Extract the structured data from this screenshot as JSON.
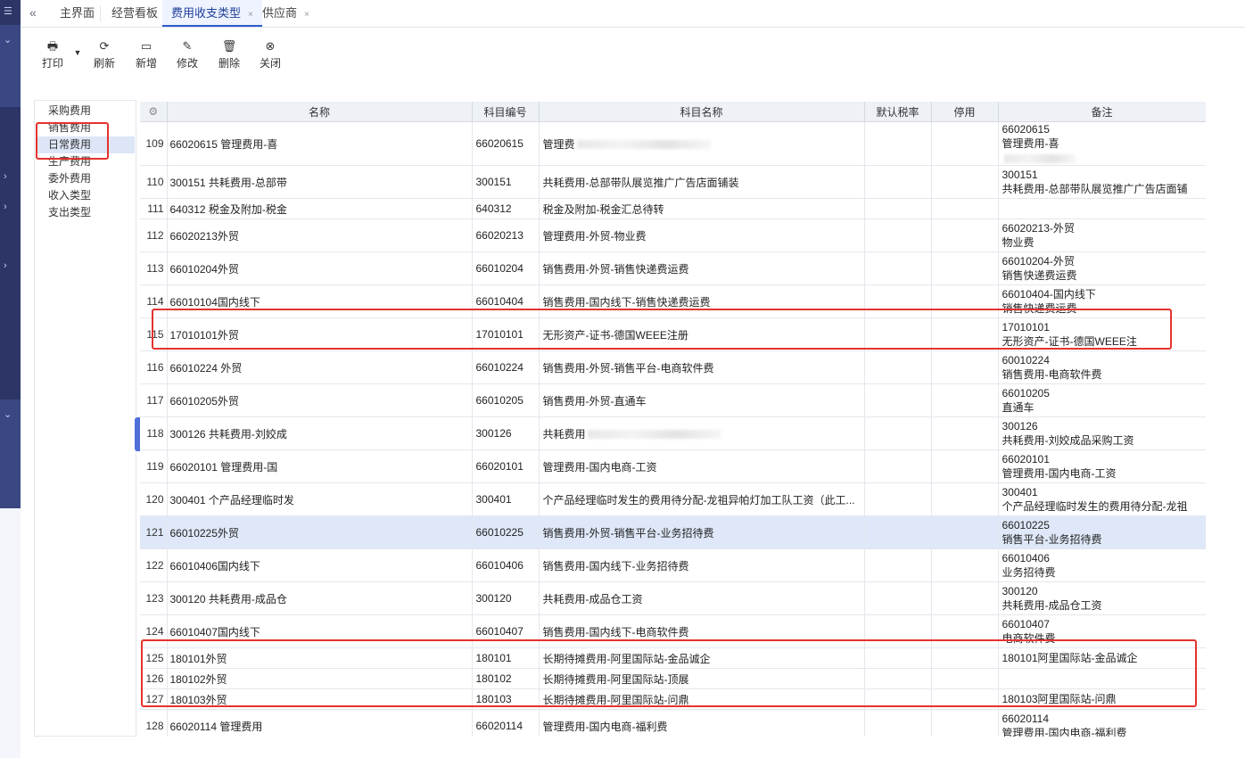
{
  "tabs": [
    {
      "label": "主界面",
      "active": false,
      "closable": false
    },
    {
      "label": "经营看板",
      "active": false,
      "closable": false
    },
    {
      "label": "费用收支类型",
      "active": true,
      "closable": true
    },
    {
      "label": "供应商",
      "active": false,
      "closable": true
    }
  ],
  "toolbar": {
    "print": "打印",
    "refresh": "刷新",
    "add": "新增",
    "edit": "修改",
    "delete": "删除",
    "close": "关闭"
  },
  "type_list": [
    "采购费用",
    "销售费用",
    "日常费用",
    "生产费用",
    "委外费用",
    "收入类型",
    "支出类型"
  ],
  "grid": {
    "columns": [
      "名称",
      "科目编号",
      "科目名称",
      "默认税率",
      "停用",
      "备注"
    ],
    "rows": [
      {
        "idx": "109",
        "name": "66020615 管理费用-喜",
        "code": "66020615",
        "subject": "管理费",
        "note1": "66020615",
        "note2": "管理费用-喜",
        "blur_subject": true,
        "blur_note": true
      },
      {
        "idx": "110",
        "name": "300151 共耗费用-总部带",
        "code": "300151",
        "subject": "共耗费用-总部带队展览推广广告店面铺装",
        "note1": "300151",
        "note2": "共耗费用-总部带队展览推广广告店面铺"
      },
      {
        "idx": "111",
        "name": "640312 税金及附加-税金",
        "code": "640312",
        "subject": "税金及附加-税金汇总待转",
        "note1": "",
        "note2": "",
        "short": true
      },
      {
        "idx": "112",
        "name": "66020213外贸",
        "code": "66020213",
        "subject": "管理费用-外贸-物业费",
        "note1": "66020213-外贸",
        "note2": "物业费"
      },
      {
        "idx": "113",
        "name": "66010204外贸",
        "code": "66010204",
        "subject": "销售费用-外贸-销售快递费运费",
        "note1": "66010204-外贸",
        "note2": "销售快递费运费"
      },
      {
        "idx": "114",
        "name": "66010104国内线下",
        "code": "66010404",
        "subject": "销售费用-国内线下-销售快递费运费",
        "note1": "66010404-国内线下",
        "note2": "销售快递费运费"
      },
      {
        "idx": "115",
        "name": "17010101外贸",
        "code": "17010101",
        "subject": "无形资产-证书-德国WEEE注册",
        "note1": "17010101",
        "note2": " 无形资产-证书-德国WEEE注"
      },
      {
        "idx": "116",
        "name": "66010224 外贸",
        "code": "66010224",
        "subject": "销售费用-外贸-销售平台-电商软件费",
        "note1": "60010224",
        "note2": "销售费用-电商软件费"
      },
      {
        "idx": "117",
        "name": "66010205外贸",
        "code": "66010205",
        "subject": "销售费用-外贸-直通车",
        "note1": "66010205",
        "note2": " 直通车"
      },
      {
        "idx": "118",
        "name": "300126 共耗费用-刘姣成",
        "code": "300126",
        "subject": "共耗费用",
        "note1": "300126",
        "note2": "共耗费用-刘姣成品采购工资",
        "blur_subject": true
      },
      {
        "idx": "119",
        "name": "66020101 管理费用-国",
        "code": "66020101",
        "subject": "管理费用-国内电商-工资",
        "note1": "66020101",
        "note2": "管理费用-国内电商-工资"
      },
      {
        "idx": "120",
        "name": "300401 个产品经理临时发",
        "code": "300401",
        "subject": "个产品经理临时发生的费用待分配-龙祖异帕灯加工队工资（此工...",
        "note1": "300401",
        "note2": "个产品经理临时发生的费用待分配-龙祖"
      },
      {
        "idx": "121",
        "name": "66010225外贸",
        "code": "66010225",
        "subject": "销售费用-外贸-销售平台-业务招待费",
        "note1": "66010225",
        "note2": "销售平台-业务招待费",
        "selected": true
      },
      {
        "idx": "122",
        "name": "66010406国内线下",
        "code": "66010406",
        "subject": "销售费用-国内线下-业务招待费",
        "note1": "66010406",
        "note2": "业务招待费"
      },
      {
        "idx": "123",
        "name": "300120 共耗费用-成品仓",
        "code": "300120",
        "subject": "共耗费用-成品仓工资",
        "note1": "300120",
        "note2": "共耗费用-成品仓工资"
      },
      {
        "idx": "124",
        "name": "66010407国内线下",
        "code": "66010407",
        "subject": "销售费用-国内线下-电商软件费",
        "note1": "66010407",
        "note2": "电商软件费"
      },
      {
        "idx": "125",
        "name": "180101外贸",
        "code": "180101",
        "subject": "长期待摊费用-阿里国际站-金品诚企",
        "note1": "180101阿里国际站-金品诚企",
        "note2": "",
        "short": true
      },
      {
        "idx": "126",
        "name": "180102外贸",
        "code": "180102",
        "subject": "长期待摊费用-阿里国际站-顶展",
        "note1": "",
        "note2": "",
        "short": true
      },
      {
        "idx": "127",
        "name": "180103外贸",
        "code": "180103",
        "subject": "长期待摊费用-阿里国际站-问鼎",
        "note1": "180103阿里国际站-问鼎",
        "note2": "",
        "short": true
      },
      {
        "idx": "128",
        "name": "66020114 管理费用",
        "code": "66020114",
        "subject": "管理费用-国内电商-福利费",
        "note1": "66020114",
        "note2": "管理费用-国内电商-福利费"
      }
    ]
  }
}
